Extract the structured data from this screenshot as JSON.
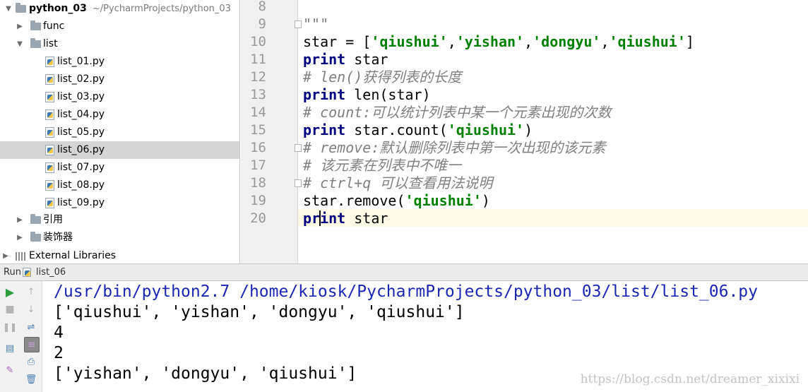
{
  "project": {
    "root_name": "python_03",
    "root_path": "~/PycharmProjects/python_03",
    "folder_func": "func",
    "folder_list": "list",
    "files": [
      "list_01.py",
      "list_02.py",
      "list_03.py",
      "list_04.py",
      "list_05.py",
      "list_06.py",
      "list_07.py",
      "list_08.py",
      "list_09.py"
    ],
    "selected_file": "list_06.py",
    "folder_ref": "引用",
    "folder_decorator": "装饰器",
    "external_libraries": "External Libraries"
  },
  "editor": {
    "line_numbers": [
      "8",
      "9",
      "10",
      "11",
      "12",
      "13",
      "14",
      "15",
      "16",
      "17",
      "18",
      "19",
      "20"
    ],
    "current_line": "20",
    "code": {
      "l9": "\"\"\"",
      "l10_a": "star = [",
      "l10_s1": "'qiushui'",
      "l10_s2": "'yishan'",
      "l10_s3": "'dongyu'",
      "l10_s4": "'qiushui'",
      "l10_b": "]",
      "kw_print": "print",
      "l11_rest": " star",
      "l12": "# len()获得列表的长度",
      "l13_rest": " len(star)",
      "l14": "# count:可以统计列表中某一个元素出现的次数",
      "l15_rest": " star.count(",
      "l15_str": "'qiushui'",
      "l15_close": ")",
      "l16": "# remove:默认删除列表中第一次出现的该元素",
      "l17": "# 该元素在列表中不唯一",
      "l18": "# ctrl+q 可以查看用法说明",
      "l19_a": "star.remove(",
      "l19_str": "'qiushui'",
      "l19_b": ")",
      "l20_kw_a": "pr",
      "l20_kw_b": "int",
      "l20_rest": " star"
    }
  },
  "run": {
    "tab_label": "Run",
    "config_name": "list_06",
    "console": [
      "/usr/bin/python2.7 /home/kiosk/PycharmProjects/python_03/list/list_06.py",
      "['qiushui', 'yishan', 'dongyu', 'qiushui']",
      "4",
      "2",
      "['yishan', 'dongyu', 'qiushui']"
    ]
  },
  "watermark": "https://blog.csdn.net/dreamer_xixixi",
  "colors": {
    "keyword": "#000080",
    "string": "#008000",
    "comment": "#808080",
    "console_command": "#1a27b4",
    "selection": "#d5d5d5",
    "caret_row": "#fffae3"
  }
}
